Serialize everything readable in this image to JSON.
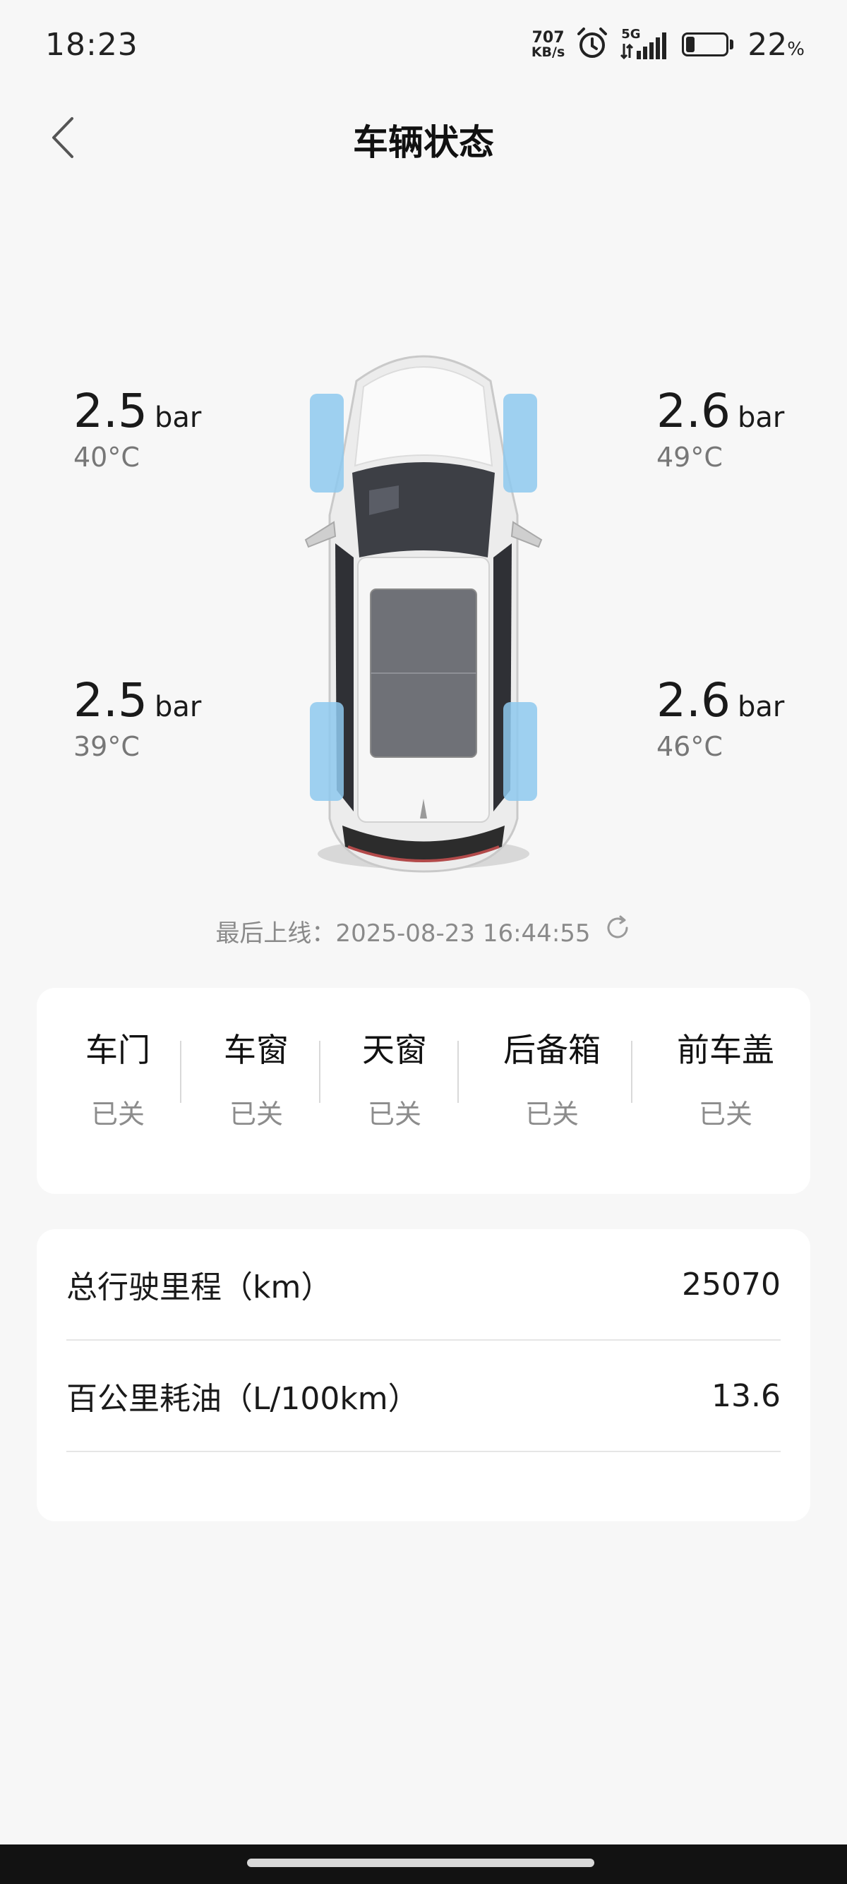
{
  "status_bar": {
    "time": "18:23",
    "net_speed_value": "707",
    "net_speed_unit": "KB/s",
    "network": "5G",
    "battery_value": "22",
    "battery_unit": "%",
    "battery_level": 0.22
  },
  "header": {
    "title": "车辆状态"
  },
  "tires": {
    "front_left": {
      "pressure": "2.5",
      "unit": "bar",
      "temp": "40°C"
    },
    "front_right": {
      "pressure": "2.6",
      "unit": "bar",
      "temp": "49°C"
    },
    "rear_left": {
      "pressure": "2.5",
      "unit": "bar",
      "temp": "39°C"
    },
    "rear_right": {
      "pressure": "2.6",
      "unit": "bar",
      "temp": "46°C"
    }
  },
  "last_online": "最后上线：2025-08-23 16:44:55",
  "vehicle_status": [
    {
      "label": "车门",
      "value": "已关"
    },
    {
      "label": "车窗",
      "value": "已关"
    },
    {
      "label": "天窗",
      "value": "已关"
    },
    {
      "label": "后备箱",
      "value": "已关"
    },
    {
      "label": "前车盖",
      "value": "已关"
    }
  ],
  "stats": [
    {
      "label": "总行驶里程（km）",
      "value": "25070"
    },
    {
      "label": "百公里耗油（L/100km）",
      "value": "13.6"
    }
  ],
  "colors": {
    "tire_highlight": "#8ec9ee",
    "background": "#f7f7f7",
    "card": "#ffffff"
  }
}
